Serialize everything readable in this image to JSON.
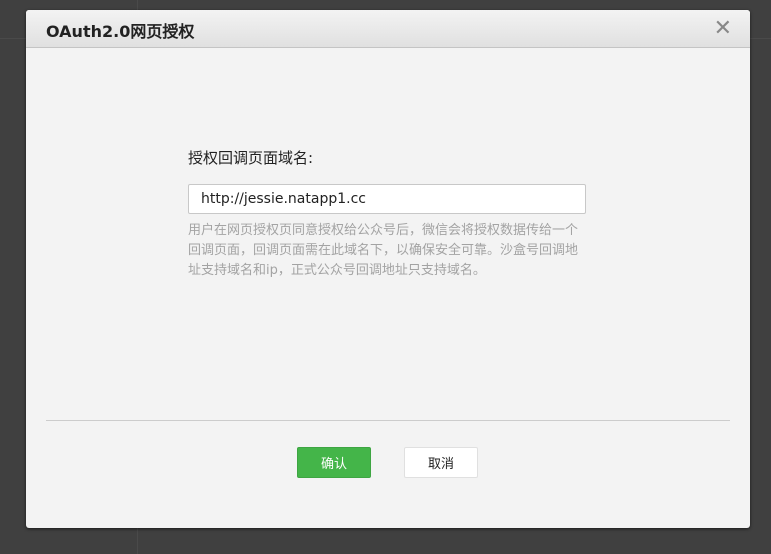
{
  "dialog": {
    "title": "OAuth2.0网页授权",
    "close_icon": "close-icon",
    "field_label": "授权回调页面域名:",
    "field_value": "http://jessie.natapp1.cc",
    "description": "用户在网页授权页同意授权给公众号后，微信会将授权数据传给一个回调页面，回调页面需在此域名下，以确保安全可靠。沙盒号回调地址支持域名和ip，正式公众号回调地址只支持域名。",
    "confirm_label": "确认",
    "cancel_label": "取消"
  },
  "colors": {
    "primary": "#44b549",
    "overlay": "#404040"
  }
}
